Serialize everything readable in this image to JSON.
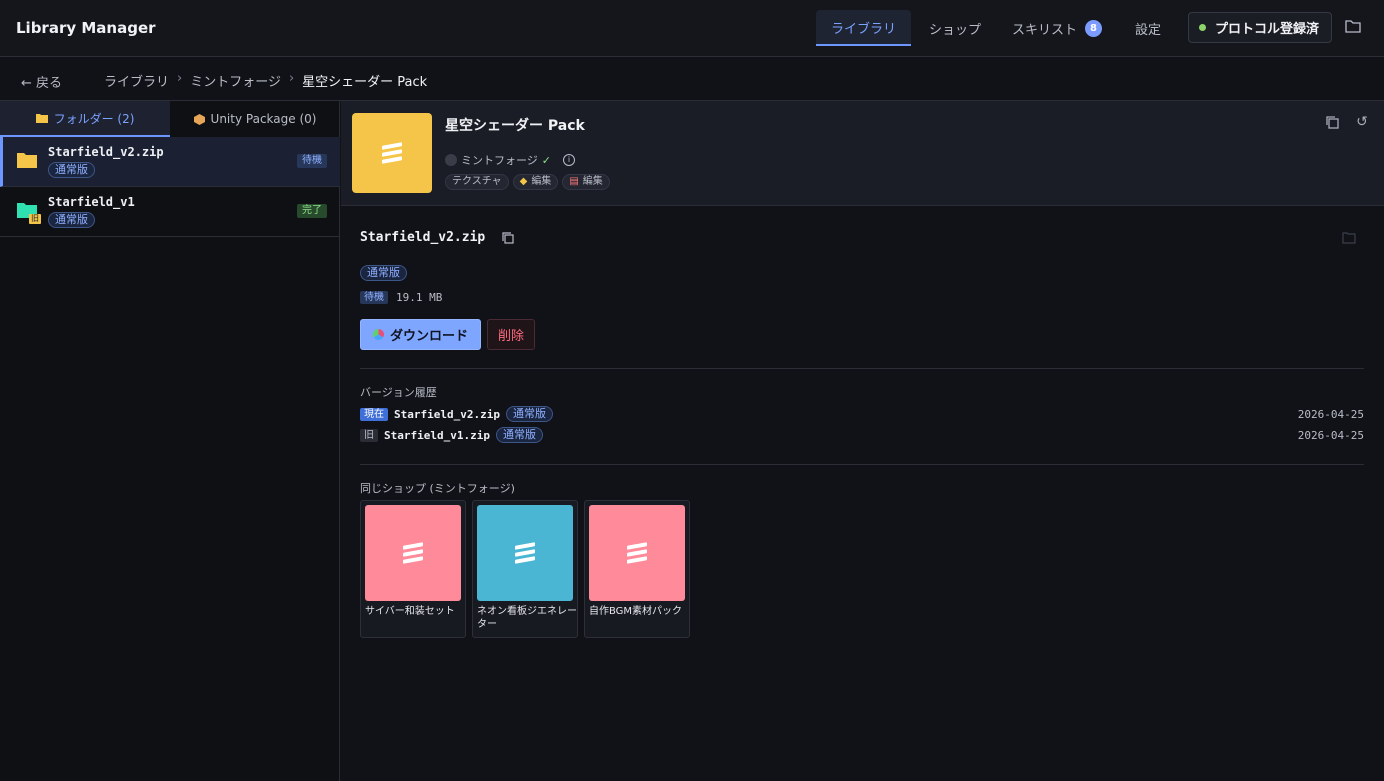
{
  "app": {
    "title": "Library Manager"
  },
  "nav": {
    "library": "ライブラリ",
    "shop": "ショップ",
    "skill": "スキリスト",
    "skill_badge": "8",
    "settings": "設定",
    "protocol": "プロトコル登録済"
  },
  "breadcrumb": {
    "back": "← 戻る",
    "items": [
      "ライブラリ",
      "ミントフォージ",
      "星空シェーダー Pack"
    ]
  },
  "left_tabs": {
    "folder": "フォルダー (2)",
    "unity": "Unity Package (0)"
  },
  "files": [
    {
      "name": "Starfield_v2.zip",
      "version": "通常版",
      "status": "待機"
    },
    {
      "name": "Starfield_v1",
      "version": "通常版",
      "status": "完了",
      "old_badge": "旧"
    }
  ],
  "pack": {
    "title": "星空シェーダー Pack",
    "shop": "ミントフォージ",
    "verified": "✓",
    "tags": [
      "テクスチャ",
      "編集",
      "編集"
    ]
  },
  "detail": {
    "file_name": "Starfield_v2.zip",
    "version": "通常版",
    "status": "待機",
    "size": "19.1 MB",
    "download": "ダウンロード",
    "delete": "削除"
  },
  "history": {
    "title": "バージョン履歴",
    "rows": [
      {
        "label": "現在",
        "name": "Starfield_v2.zip",
        "version": "通常版",
        "date": "2026-04-25"
      },
      {
        "label": "旧",
        "name": "Starfield_v1.zip",
        "version": "通常版",
        "date": "2026-04-25"
      }
    ]
  },
  "same_shop": {
    "title": "同じショップ (ミントフォージ)",
    "items": [
      {
        "title": "サイバー和装セット",
        "color": "#ff8a99"
      },
      {
        "title": "ネオン看板ジエネレーター",
        "color": "#4bb6d4"
      },
      {
        "title": "自作BGM素材パック",
        "color": "#ff8a99"
      }
    ]
  },
  "colors": {
    "accent": "#6d96ff",
    "thumb": "#f4c548"
  }
}
